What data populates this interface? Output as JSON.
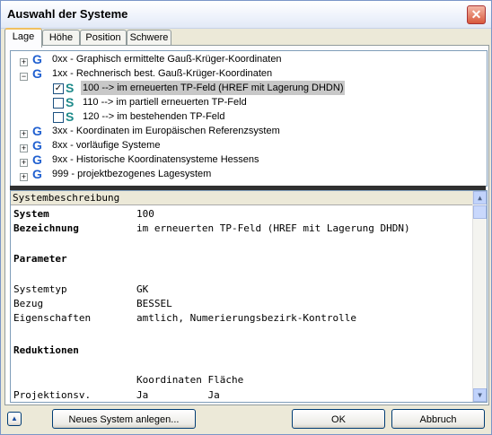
{
  "window": {
    "title": "Auswahl der Systeme",
    "close_glyph": "✕"
  },
  "tabs": [
    {
      "label": "Lage",
      "active": true
    },
    {
      "label": "Höhe",
      "active": false
    },
    {
      "label": "Position",
      "active": false
    },
    {
      "label": "Schwere",
      "active": false
    }
  ],
  "tree": {
    "nodes": [
      {
        "label": "0xx - Graphisch ermittelte Gauß-Krüger-Koordinaten",
        "expander": "+",
        "icon": "G"
      },
      {
        "label": "1xx - Rechnerisch best. Gauß-Krüger-Koordinaten",
        "expander": "−",
        "icon": "G"
      },
      {
        "label": "100 --> im erneuerten TP-Feld (HREF mit Lagerung DHDN)",
        "checked": true,
        "selected": true,
        "icon": "S"
      },
      {
        "label": "110 --> im partiell erneuerten TP-Feld",
        "checked": false,
        "icon": "S"
      },
      {
        "label": "120 --> im bestehenden TP-Feld",
        "checked": false,
        "icon": "S"
      },
      {
        "label": "3xx - Koordinaten im Europäischen Referenzsystem",
        "expander": "+",
        "icon": "G"
      },
      {
        "label": "8xx - vorläufige Systeme",
        "expander": "+",
        "icon": "G"
      },
      {
        "label": "9xx - Historische Koordinatensysteme Hessens",
        "expander": "+",
        "icon": "G"
      },
      {
        "label": "999 - projektbezogenes Lagesystem",
        "expander": "+",
        "icon": "G"
      }
    ]
  },
  "description": {
    "header": "Systembeschreibung",
    "system_label": "System",
    "system_value": "100",
    "bezeichnung_label": "Bezeichnung",
    "bezeichnung_value": "im erneuerten TP-Feld (HREF mit Lagerung DHDN)",
    "parameter_heading": "Parameter",
    "systemtyp_label": "Systemtyp",
    "systemtyp_value": "GK",
    "bezug_label": "Bezug",
    "bezug_value": "BESSEL",
    "eigenschaften_label": "Eigenschaften",
    "eigenschaften_value": "amtlich, Numerierungsbezirk-Kontrolle",
    "reduktionen_heading": "Reduktionen",
    "reduktionen_columns": "Koordinaten Fläche",
    "projektion_label": "Projektionsv.",
    "projektion_value": "Ja          Ja"
  },
  "buttons": {
    "collapse_glyph": "▲",
    "new_system": "Neues System anlegen...",
    "ok": "OK",
    "cancel": "Abbruch"
  }
}
